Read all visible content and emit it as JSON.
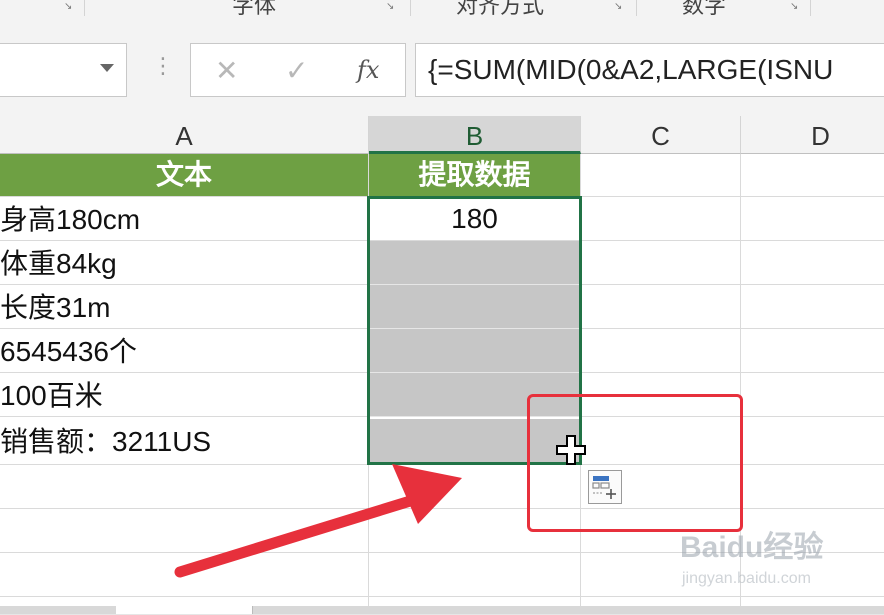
{
  "ribbon": {
    "groups": [
      "字体",
      "对齐方式",
      "数字"
    ]
  },
  "formula_bar": {
    "name_box_value": "",
    "cancel_glyph": "✕",
    "enter_glyph": "✓",
    "fx_label": "fx",
    "formula": "{=SUM(MID(0&A2,LARGE(ISNU"
  },
  "columns": [
    "A",
    "B",
    "C",
    "D"
  ],
  "selected_column": "B",
  "header_row": {
    "a": "文本",
    "b": "提取数据"
  },
  "rows": [
    {
      "a": "身高180cm",
      "b": "180"
    },
    {
      "a": "体重84kg",
      "b": ""
    },
    {
      "a": "长度31m",
      "b": ""
    },
    {
      "a": "6545436个",
      "b": ""
    },
    {
      "a": "100百米",
      "b": ""
    },
    {
      "a": "销售额：3211US",
      "b": ""
    }
  ],
  "colors": {
    "header_fill": "#6ea043",
    "selection_border": "#217346",
    "filled_cells": "#c6c6c6",
    "annotation_red": "#e7303c"
  },
  "icons": {
    "fill_cursor": "crosshair-plus-icon",
    "quick_analysis": "quick-analysis-icon",
    "annotation": "arrow-annotation"
  },
  "watermark": {
    "main": "Baidu经验",
    "sub": "jingyan.baidu.com"
  }
}
